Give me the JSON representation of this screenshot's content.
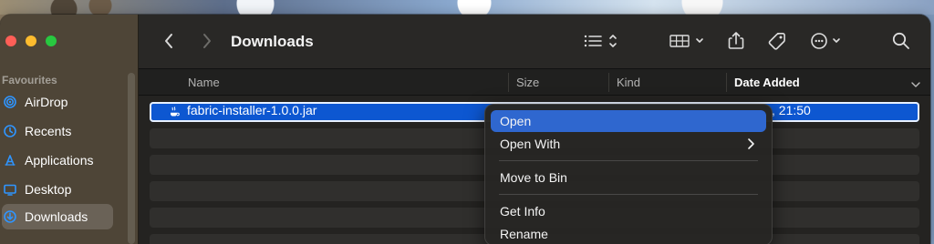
{
  "window": {
    "title": "Downloads"
  },
  "sidebar": {
    "section_title": "Favourites",
    "items": [
      {
        "label": "AirDrop",
        "icon": "airdrop-icon",
        "selected": false
      },
      {
        "label": "Recents",
        "icon": "clock-icon",
        "selected": false
      },
      {
        "label": "Applications",
        "icon": "applications-icon",
        "selected": false
      },
      {
        "label": "Desktop",
        "icon": "desktop-icon",
        "selected": false
      },
      {
        "label": "Downloads",
        "icon": "downloads-icon",
        "selected": true
      }
    ]
  },
  "toolbar": {
    "back_icon": "chevron-left-icon",
    "forward_icon": "chevron-right-icon",
    "list_view_icon": "list-view-icon",
    "group_icon": "grid-group-icon",
    "share_icon": "share-icon",
    "tag_icon": "tag-icon",
    "more_icon": "more-icon",
    "search_icon": "search-icon"
  },
  "columns": {
    "name": "Name",
    "size": "Size",
    "kind": "Kind",
    "date_added": "Date Added"
  },
  "files": [
    {
      "name": "fabric-installer-1.0.0.jar",
      "date_added_visible": ", 21:50",
      "selected": true,
      "icon": "java-icon"
    }
  ],
  "context_menu": {
    "items": [
      {
        "label": "Open",
        "highlighted": true
      },
      {
        "label": "Open With",
        "has_submenu": true
      },
      {
        "label": "Move to Bin"
      },
      {
        "label": "Get Info"
      },
      {
        "label": "Rename"
      }
    ]
  },
  "colors": {
    "selection_blue": "#0d57d1",
    "menu_highlight": "#2f67cf",
    "sidebar_icon_blue": "#2f95ff"
  }
}
